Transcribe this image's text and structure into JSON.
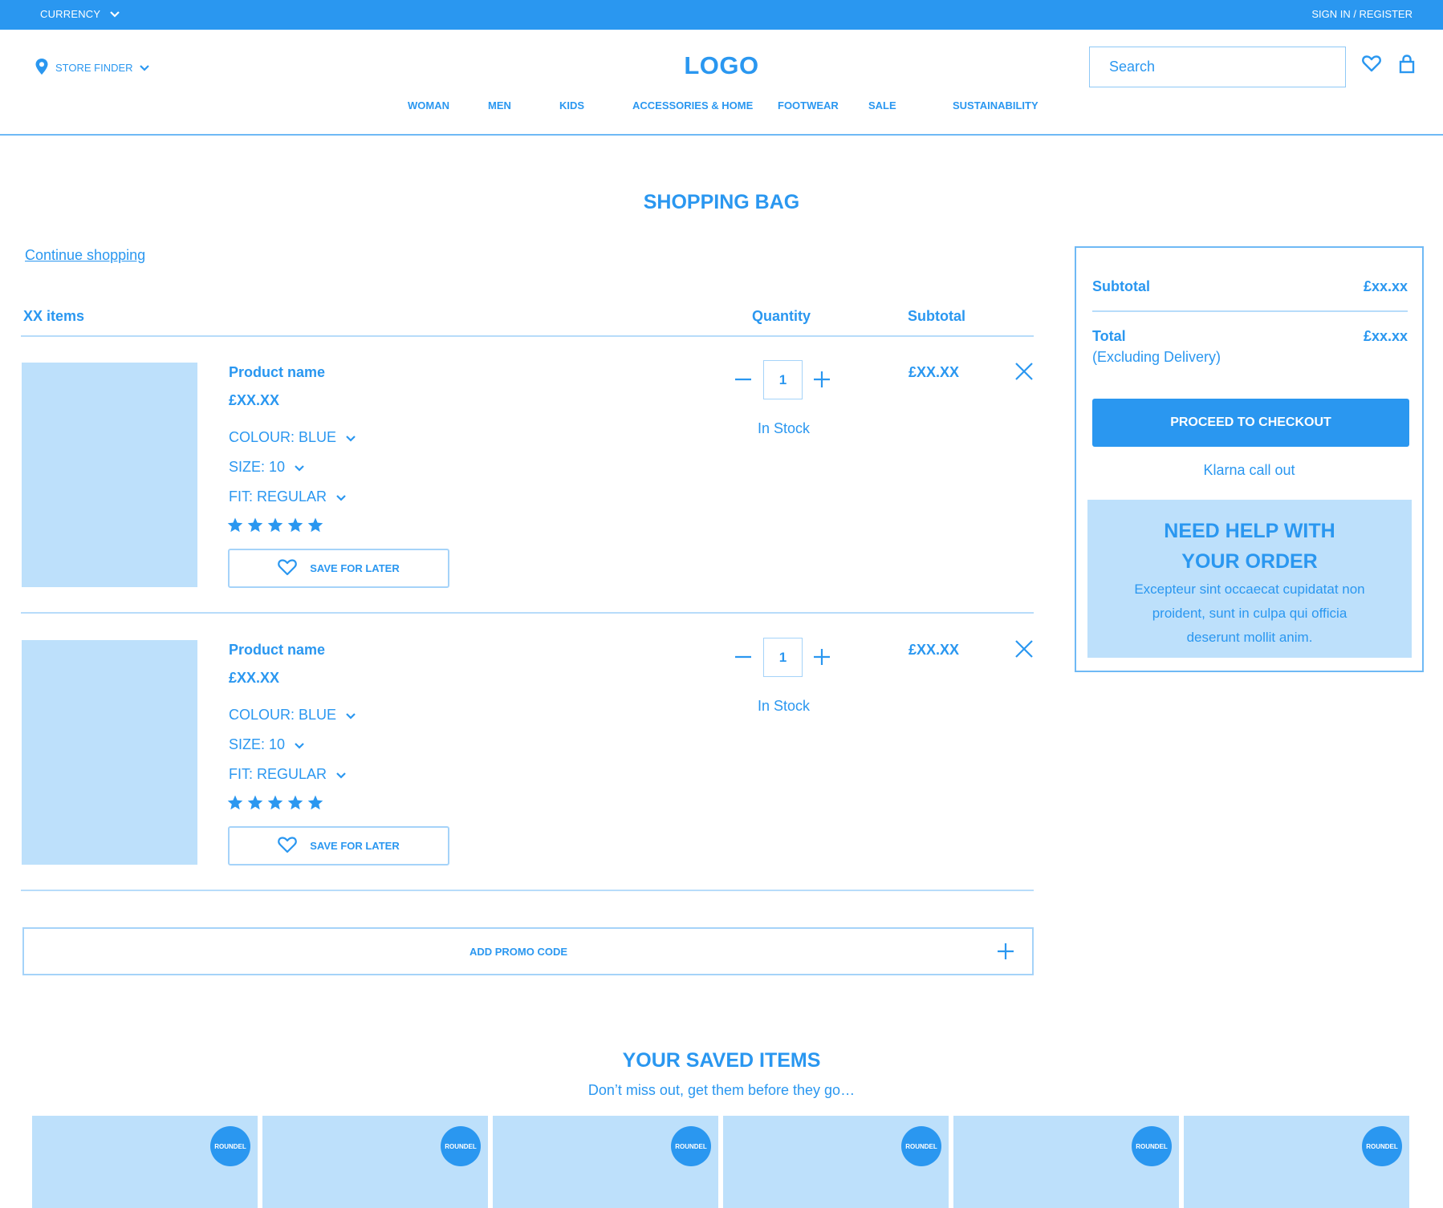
{
  "topbar": {
    "currency_label": "CURRENCY",
    "signin_label": "SIGN IN / REGISTER"
  },
  "header": {
    "store_finder_label": "STORE FINDER",
    "logo_text": "LOGO",
    "search_placeholder": "Search",
    "nav": [
      "WOMAN",
      "MEN",
      "KIDS",
      "ACCESSORIES & HOME",
      "FOOTWEAR",
      "SALE",
      "SUSTAINABILITY"
    ]
  },
  "page": {
    "title": "SHOPPING BAG",
    "continue_label": "Continue shopping",
    "items_count_label": "XX items",
    "quantity_heading": "Quantity",
    "subtotal_heading": "Subtotal"
  },
  "items": [
    {
      "name": "Product name",
      "price": "£XX.XX",
      "colour": "COLOUR: BLUE",
      "size": "SIZE: 10",
      "fit": "FIT: REGULAR",
      "rating": 5,
      "save_label": "SAVE FOR LATER",
      "quantity": "1",
      "stock": "In Stock",
      "line_price": "£XX.XX"
    },
    {
      "name": "Product name",
      "price": "£XX.XX",
      "colour": "COLOUR: BLUE",
      "size": "SIZE: 10",
      "fit": "FIT: REGULAR",
      "rating": 5,
      "save_label": "SAVE FOR LATER",
      "quantity": "1",
      "stock": "In Stock",
      "line_price": "£XX.XX"
    }
  ],
  "promo": {
    "label": "ADD PROMO CODE"
  },
  "summary": {
    "subtotal_label": "Subtotal",
    "subtotal_value": "£xx.xx",
    "total_label": "Total",
    "total_note": "(Excluding Delivery)",
    "total_value": "£xx.xx",
    "checkout_label": "PROCEED TO CHECKOUT",
    "klarna_label": "Klarna call out",
    "help_title_line1": "NEED HELP WITH",
    "help_title_line2": "YOUR ORDER",
    "help_text": "Excepteur sint occaecat cupidatat non proident, sunt in culpa qui officia deserunt mollit anim."
  },
  "saved": {
    "title": "YOUR SAVED ITEMS",
    "subtitle": "Don’t miss out, get them before they go…",
    "cards": [
      {
        "roundel": "ROUNDEL"
      },
      {
        "roundel": "ROUNDEL"
      },
      {
        "roundel": "ROUNDEL"
      },
      {
        "roundel": "ROUNDEL"
      },
      {
        "roundel": "ROUNDEL"
      },
      {
        "roundel": "ROUNDEL"
      }
    ]
  },
  "colors": {
    "primary": "#2a97f0",
    "light_fill": "#bde0fb",
    "border": "#a5d3f9"
  }
}
